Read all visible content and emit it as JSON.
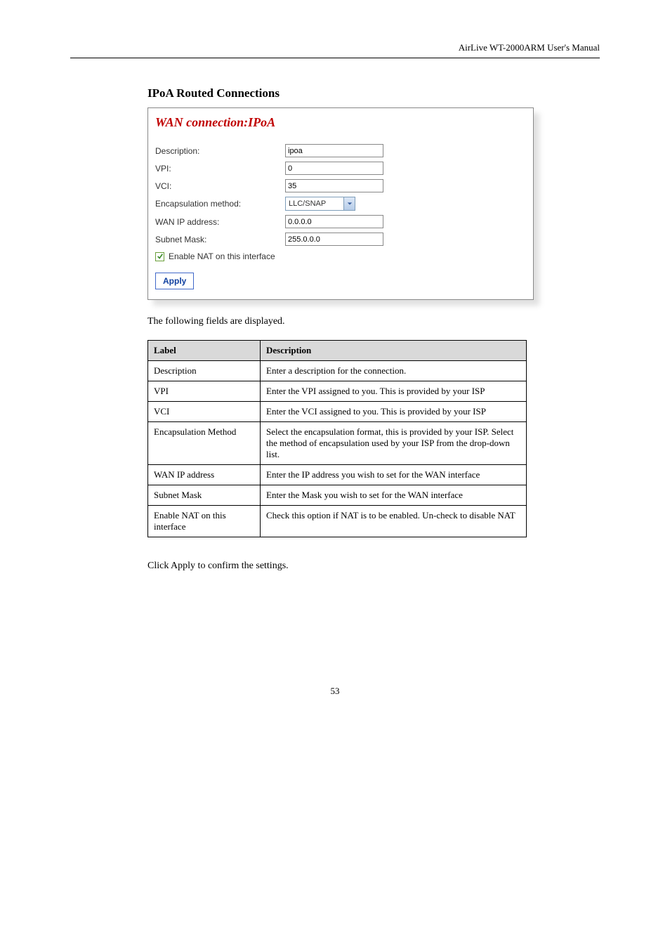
{
  "header": {
    "doc_title": "AirLive WT-2000ARM User's Manual"
  },
  "section": {
    "heading": "IPoA Routed Connections"
  },
  "panel": {
    "title": "WAN connection:IPoA",
    "labels": {
      "description": "Description:",
      "vpi": "VPI:",
      "vci": "VCI:",
      "encaps": "Encapsulation method:",
      "wanip": "WAN IP address:",
      "subnet": "Subnet Mask:",
      "nat": "Enable NAT on this interface"
    },
    "values": {
      "description": "ipoa",
      "vpi": "0",
      "vci": "35",
      "encaps": "LLC/SNAP",
      "wanip": "0.0.0.0",
      "subnet": "255.0.0.0"
    },
    "apply": "Apply"
  },
  "intro": "The following fields are displayed.",
  "table": {
    "headers": {
      "label": "Label",
      "desc": "Description"
    },
    "rows": [
      {
        "label": "Description",
        "desc": "Enter a description for the connection."
      },
      {
        "label": "VPI",
        "desc": "Enter the VPI assigned to you. This is provided by your ISP"
      },
      {
        "label": "VCI",
        "desc": "Enter the VCI assigned to you. This is provided by your ISP"
      },
      {
        "label": "Encapsulation Method",
        "desc": "Select the encapsulation format, this is provided by your ISP. Select the method of encapsulation used by your ISP from the drop-down list."
      },
      {
        "label": "WAN IP address",
        "desc": "Enter the IP address you wish to set for the WAN interface"
      },
      {
        "label": "Subnet Mask",
        "desc": "Enter the Mask you wish to set for the WAN interface"
      },
      {
        "label": "Enable NAT on this interface",
        "desc": "Check this option if NAT is to be enabled. Un-check to disable NAT"
      }
    ]
  },
  "closing": "Click Apply to confirm the settings.",
  "footer": {
    "page": "53"
  }
}
